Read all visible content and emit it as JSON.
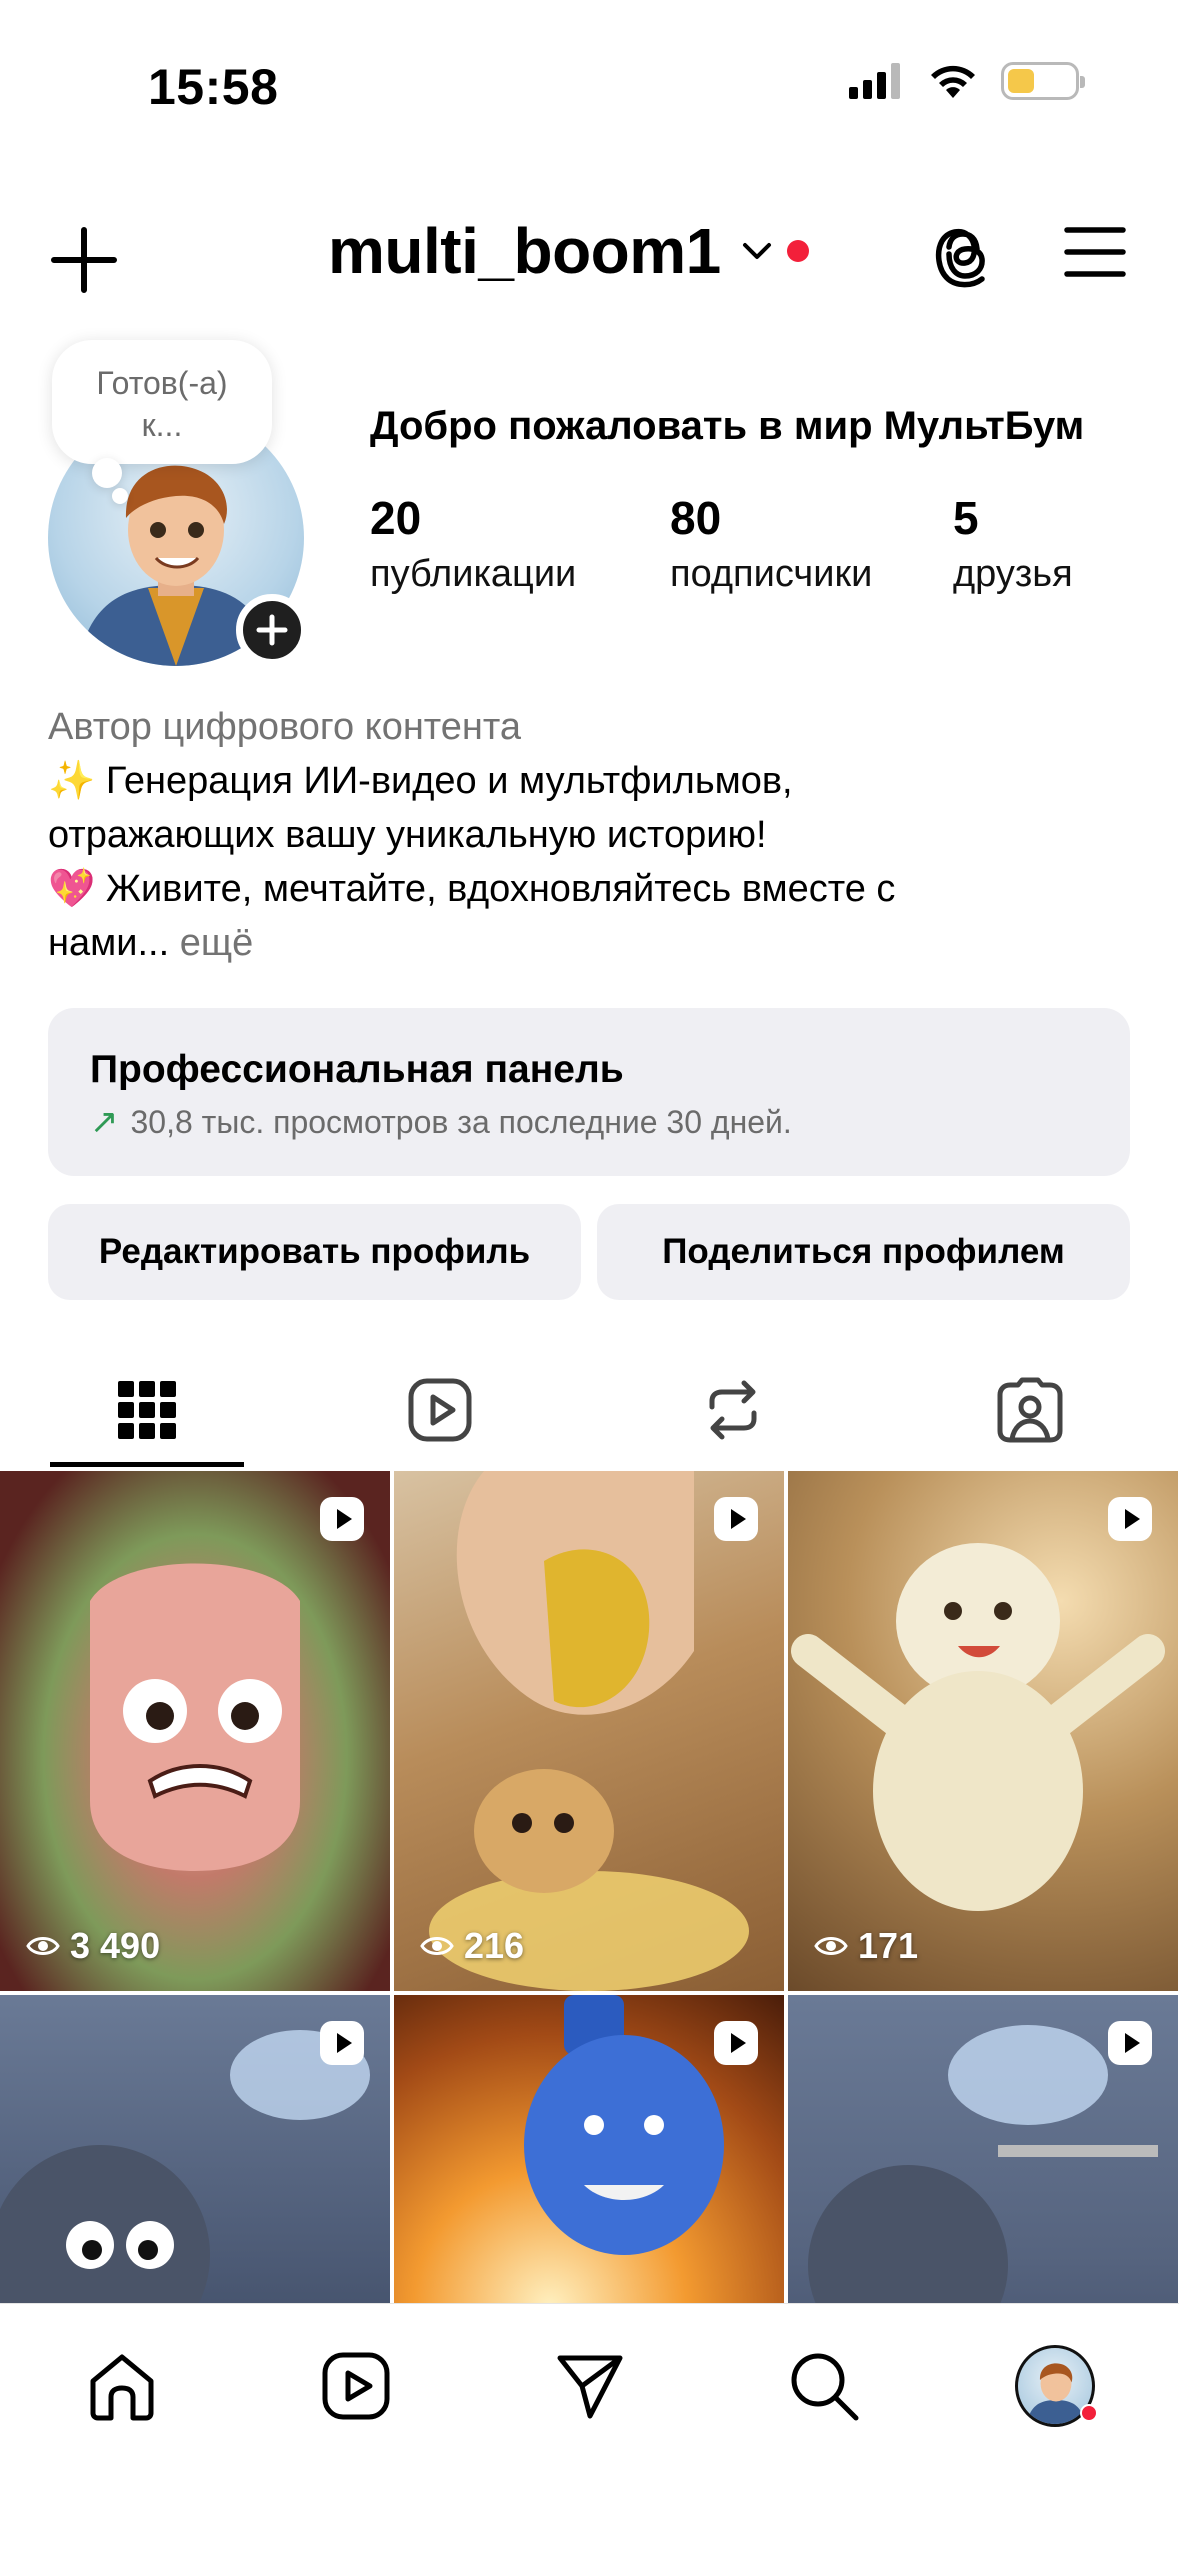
{
  "status_bar": {
    "time": "15:58"
  },
  "header": {
    "username": "multi_boom1"
  },
  "profile": {
    "note": "Готов(-а) к...",
    "name": "Добро пожаловать в мир МультБум",
    "stats": [
      {
        "value": "20",
        "label": "публикации"
      },
      {
        "value": "80",
        "label": "подписчики"
      },
      {
        "value": "5",
        "label": "друзья"
      }
    ],
    "bio": {
      "category": "Автор цифрового контента",
      "line1": "✨ Генерация ИИ-видео и мультфильмов,",
      "line2": "отражающих вашу уникальную историю!",
      "line3": "💖 Живите, мечтайте, вдохновляйтесь вместе с",
      "line4": "нами...",
      "more": "ещё"
    }
  },
  "pro_panel": {
    "title": "Профессиональная панель",
    "arrow": "↗",
    "subtitle": "30,8 тыс. просмотров за последние 30 дней."
  },
  "buttons": {
    "edit": "Редактировать профиль",
    "share": "Поделиться профилем"
  },
  "tabs": [
    "grid-icon",
    "reels-icon",
    "reposts-icon",
    "tagged-icon"
  ],
  "posts": [
    {
      "views": "3 490"
    },
    {
      "views": "216"
    },
    {
      "views": "171"
    },
    {
      "views": ""
    },
    {
      "views": ""
    },
    {
      "views": ""
    }
  ],
  "bottom_nav": [
    "home-icon",
    "reels-icon",
    "send-icon",
    "search-icon",
    "profile-avatar"
  ],
  "colors": {
    "accent_red": "#f3203a",
    "panel_bg": "#efeff3",
    "growth_green": "#2f9a55"
  }
}
